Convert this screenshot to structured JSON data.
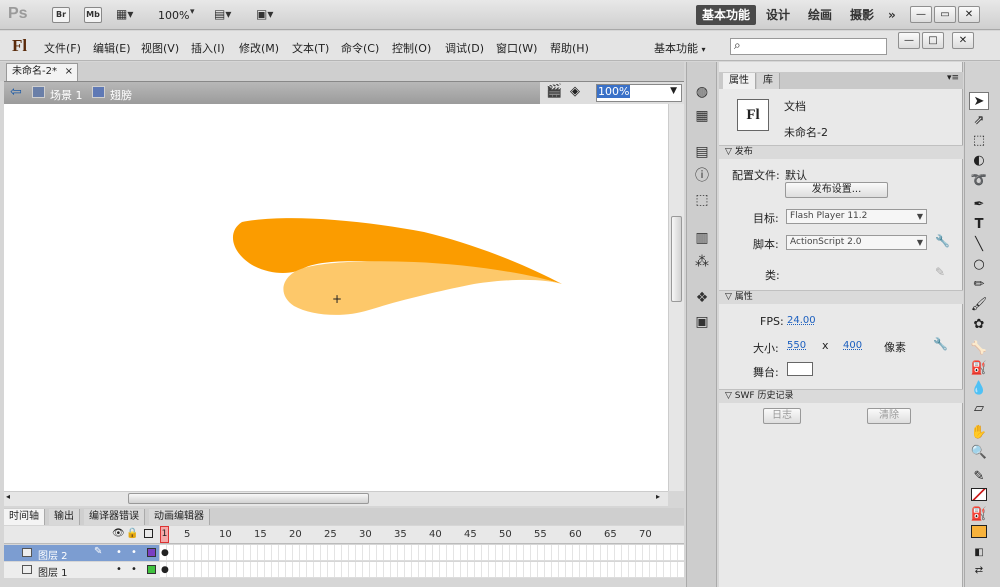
{
  "appbar": {
    "ps_logo": "Ps",
    "br": "Br",
    "mb": "Mb",
    "zoom": "100%",
    "workspaces": [
      "基本功能",
      "设计",
      "绘画",
      "摄影"
    ],
    "more": "»"
  },
  "menubar": {
    "logo": "Fl",
    "items": [
      "文件(F)",
      "编辑(E)",
      "视图(V)",
      "插入(I)",
      "修改(M)",
      "文本(T)",
      "命令(C)",
      "控制(O)",
      "调试(D)",
      "窗口(W)",
      "帮助(H)"
    ],
    "workspace": "基本功能",
    "search_placeholder": ""
  },
  "document": {
    "tab_title": "未命名-2*",
    "scene": "场景 1",
    "symbol": "翅膀",
    "zoom": "100%"
  },
  "timeline": {
    "tabs": [
      "时间轴",
      "输出",
      "编译器错误",
      "动画编辑器"
    ],
    "frame_numbers": [
      "1",
      "5",
      "10",
      "15",
      "20",
      "25",
      "30",
      "35",
      "40",
      "45",
      "50",
      "55",
      "60",
      "65",
      "70"
    ],
    "layers": [
      {
        "name": "图层 2",
        "color": "#7a3fc2",
        "selected": true
      },
      {
        "name": "图层 1",
        "color": "#3fc23f",
        "selected": false
      }
    ]
  },
  "properties": {
    "tabs": [
      "属性",
      "库"
    ],
    "doc_icon": "Fl",
    "doc_type": "文档",
    "doc_name": "未命名-2",
    "section_publish": "发布",
    "profile_label": "配置文件:",
    "profile_value": "默认",
    "publish_settings_btn": "发布设置...",
    "target_label": "目标:",
    "target_value": "Flash Player 11.2",
    "script_label": "脚本:",
    "script_value": "ActionScript 2.0",
    "class_label": "类:",
    "section_props": "属性",
    "fps_label": "FPS:",
    "fps_value": "24.00",
    "size_label": "大小:",
    "width": "550",
    "x": "x",
    "height": "400",
    "unit": "像素",
    "stage_label": "舞台:",
    "section_swf": "SWF 历史记录",
    "log_btn": "日志",
    "clear_btn": "清除"
  },
  "colors": {
    "wing_dark": "#fb9c00",
    "wing_light": "#fdc86a",
    "stroke_color": "#cc2222",
    "fill_color": "#f7b23b"
  }
}
